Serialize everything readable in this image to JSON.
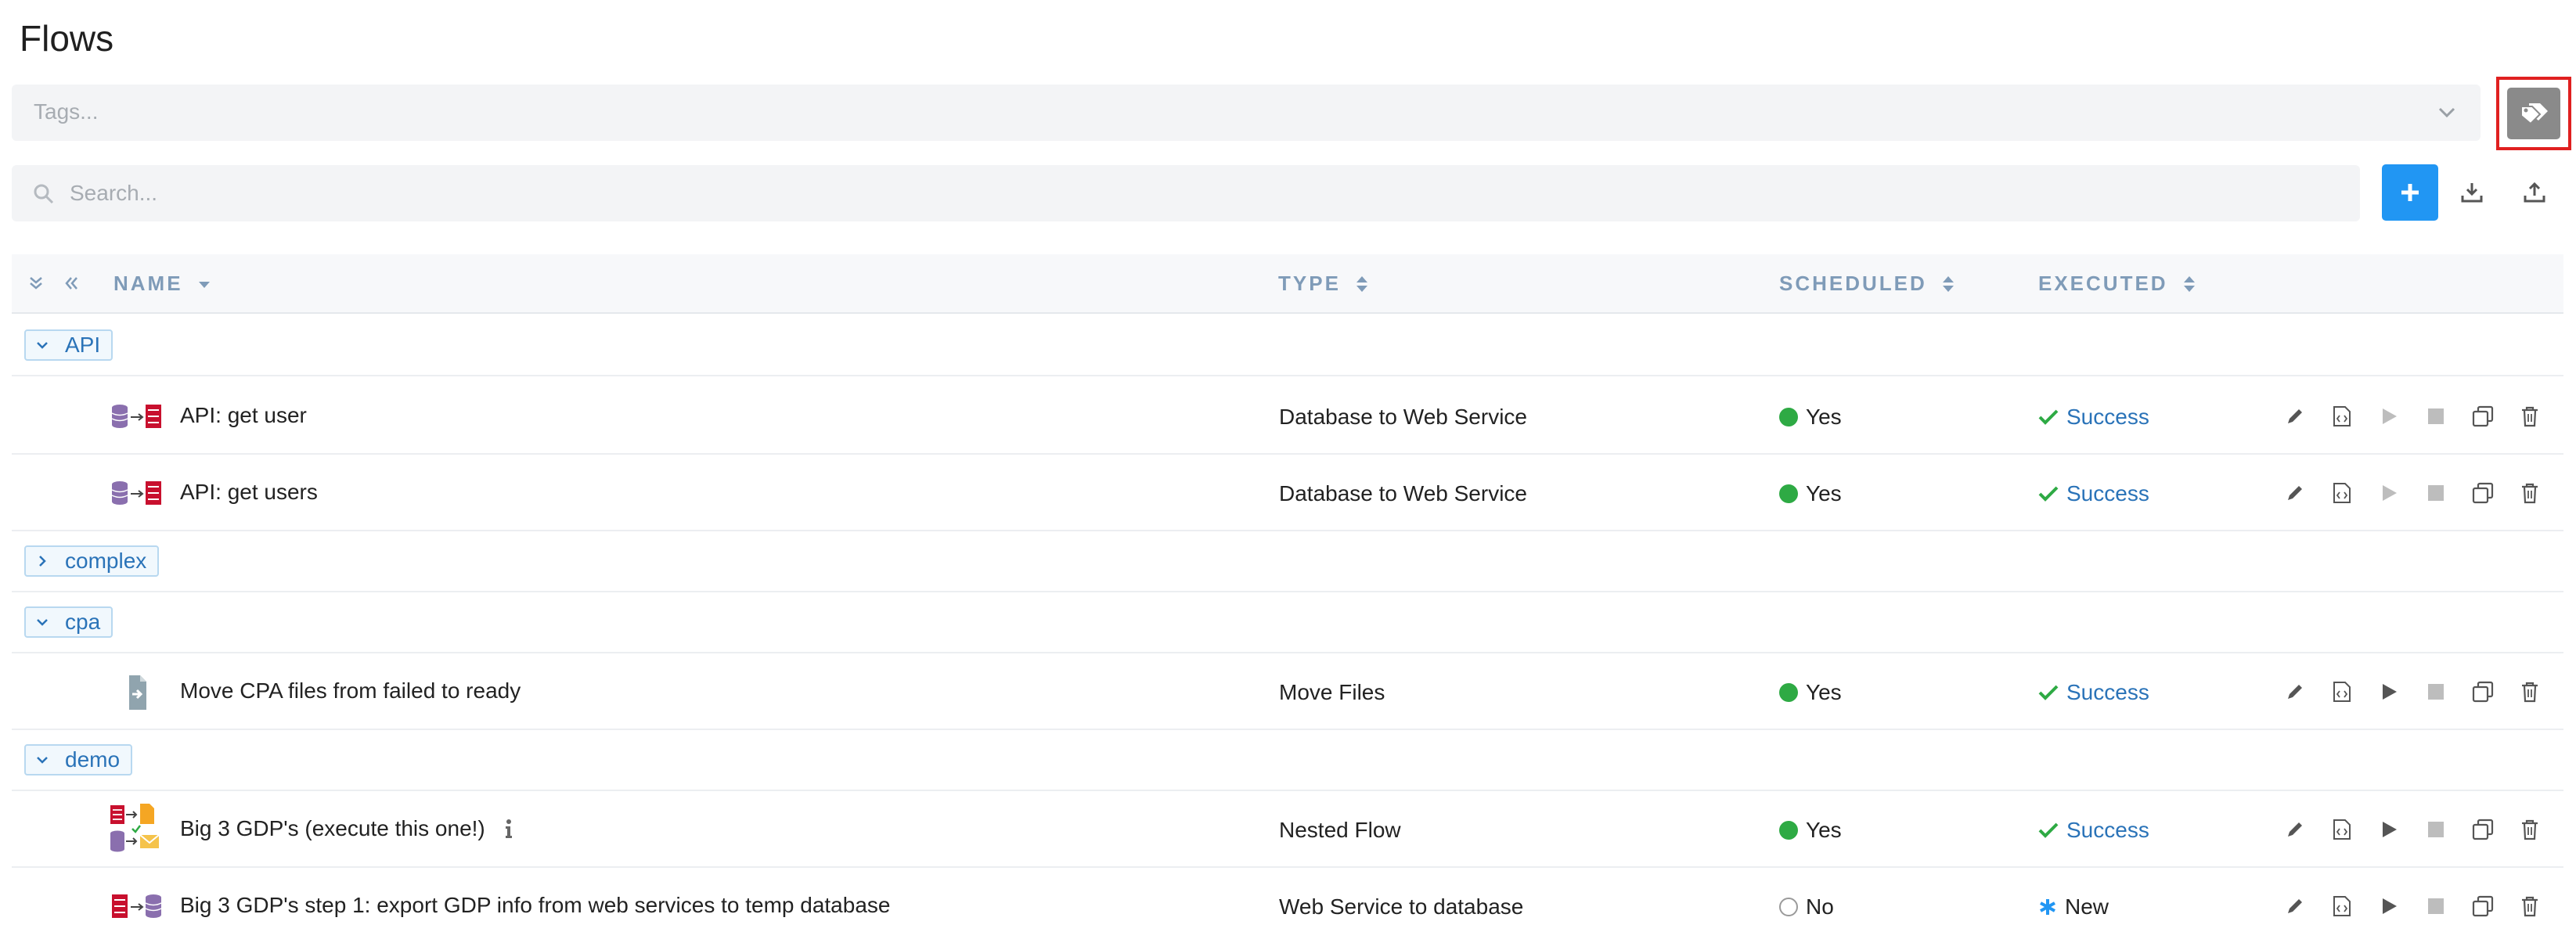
{
  "page": {
    "title": "Flows"
  },
  "tags": {
    "placeholder": "Tags..."
  },
  "search": {
    "placeholder": "Search..."
  },
  "table": {
    "columns": {
      "name": "NAME",
      "type": "TYPE",
      "scheduled": "SCHEDULED",
      "executed": "EXECUTED"
    }
  },
  "groups": [
    {
      "label": "API",
      "expanded": true
    },
    {
      "label": "complex",
      "expanded": false
    },
    {
      "label": "cpa",
      "expanded": true
    },
    {
      "label": "demo",
      "expanded": true
    }
  ],
  "flows": [
    {
      "name": "API: get user",
      "type": "Database to Web Service",
      "scheduled": "Yes",
      "executed": "Success",
      "icon": "database-to-webservice-icon"
    },
    {
      "name": "API: get users",
      "type": "Database to Web Service",
      "scheduled": "Yes",
      "executed": "Success",
      "icon": "database-to-webservice-icon"
    },
    {
      "name": "Move CPA files from failed to ready",
      "type": "Move Files",
      "scheduled": "Yes",
      "executed": "Success",
      "icon": "move-files-icon"
    },
    {
      "name": "Big 3 GDP's (execute this one!)",
      "type": "Nested Flow",
      "scheduled": "Yes",
      "executed": "Success",
      "icon": "nested-flow-icon"
    },
    {
      "name": "Big 3 GDP's step 1: export GDP info from web services to temp database",
      "type": "Web Service to database",
      "scheduled": "No",
      "executed": "New",
      "icon": "webservice-to-database-icon"
    }
  ],
  "colors": {
    "accent": "#2196f3",
    "success": "#2eaa44",
    "link": "#2a73b8",
    "header_text": "#7f9bb8",
    "highlight": "#e02020"
  }
}
